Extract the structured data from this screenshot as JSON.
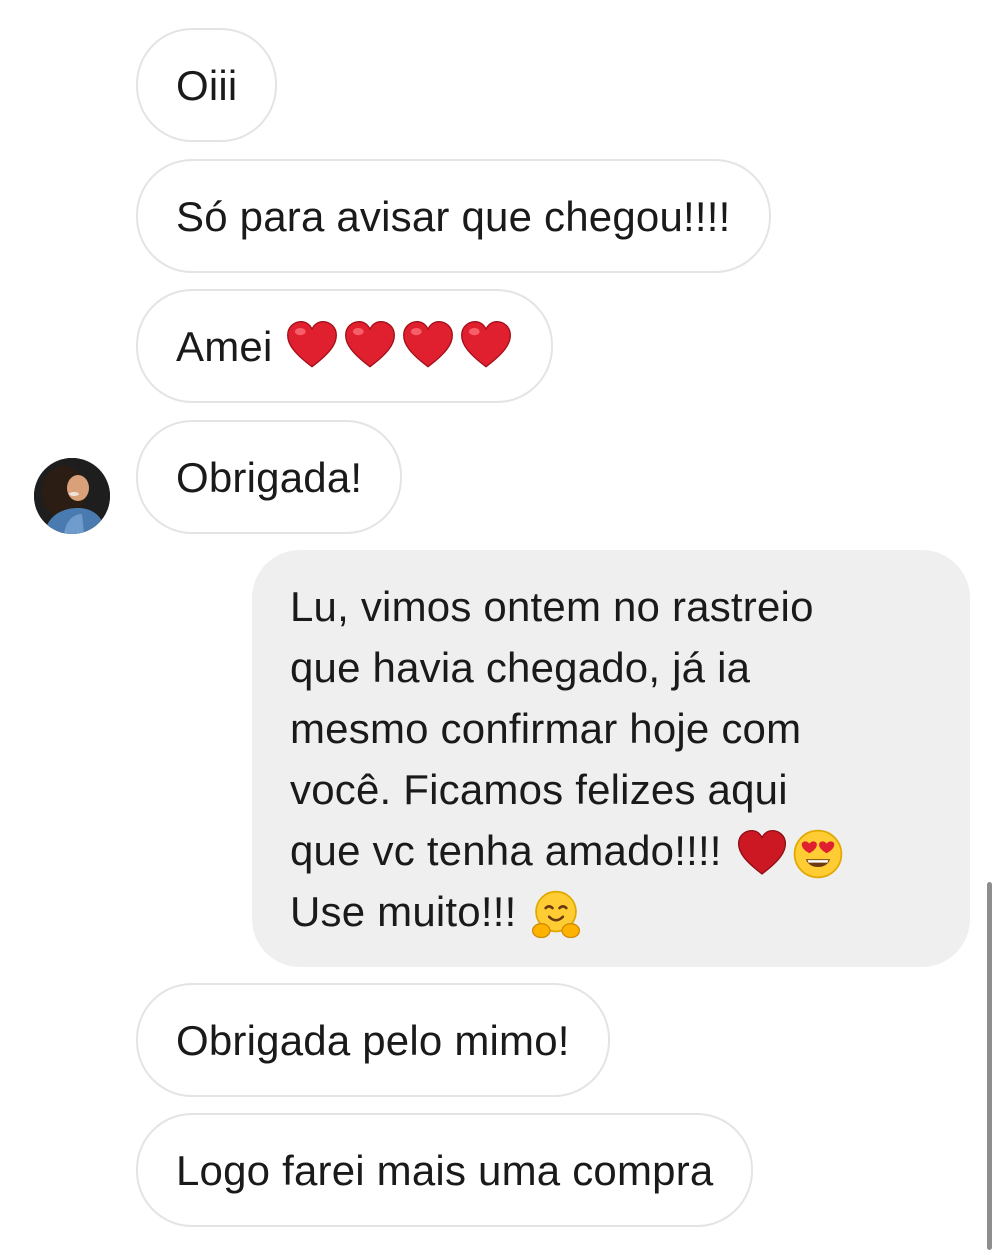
{
  "messages": {
    "m1": "Oiii",
    "m2": "Só para avisar que chegou!!!!",
    "m3": "Amei",
    "m4": "Obrigada!",
    "m5": {
      "lines": [
        "Lu, vimos ontem no rastreio",
        "que havia chegado, já ia",
        "mesmo confirmar hoje com",
        "você. Ficamos felizes aqui",
        "que vc tenha amado!!!!",
        "Use muito!!!"
      ]
    },
    "m6": "Obrigada pelo mimo!",
    "m7": "Logo farei mais uma compra"
  },
  "colors": {
    "incoming_border": "#e4e4e4",
    "outgoing_bg": "#efefef",
    "heart": "#e0202e",
    "text": "#1a1a1a"
  },
  "icons": {
    "avatar": "contact-avatar",
    "heart": "red-heart-emoji",
    "heart_eyes": "heart-eyes-emoji",
    "hug": "hugging-face-emoji"
  }
}
